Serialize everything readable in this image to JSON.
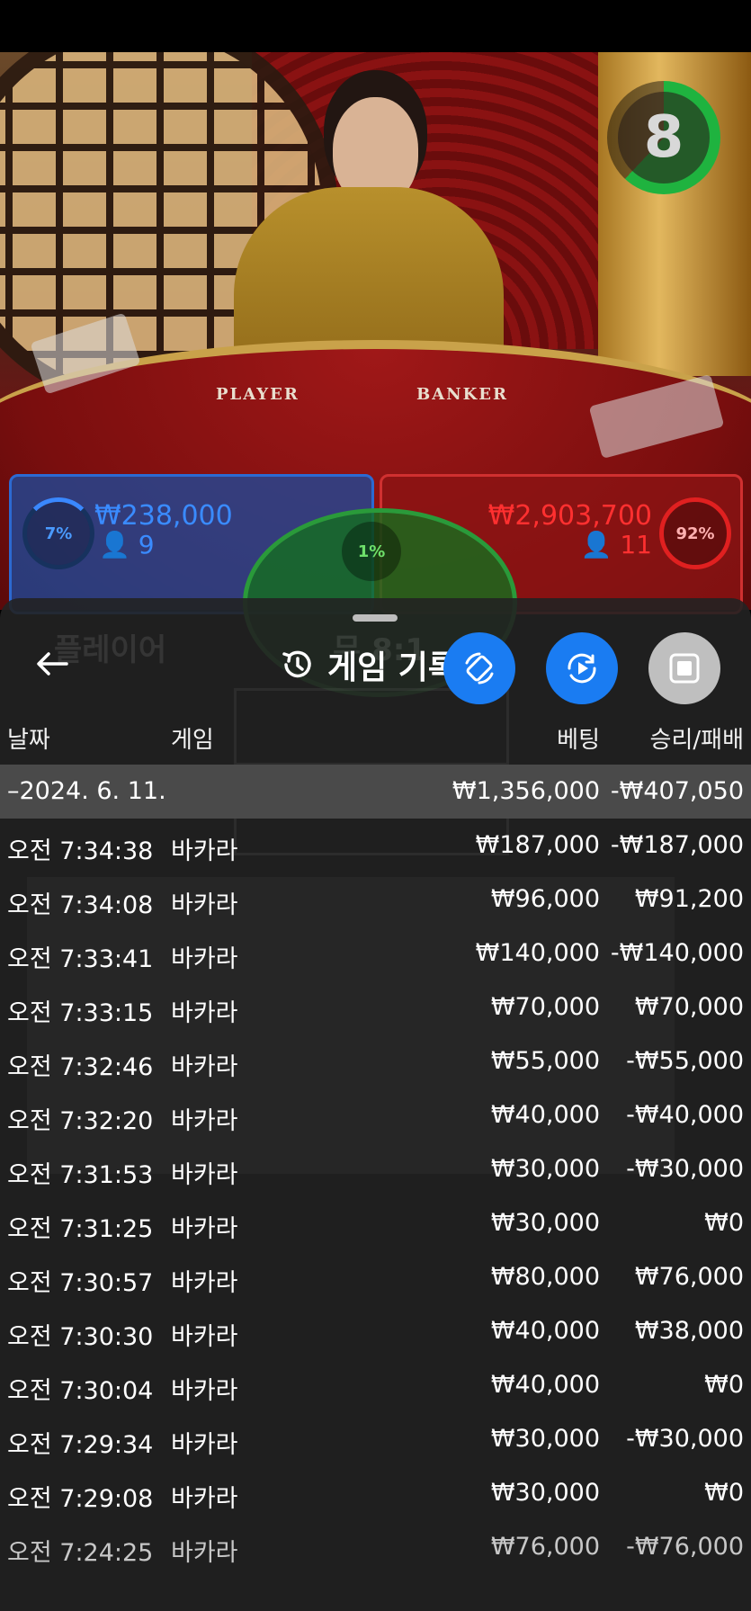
{
  "game_view": {
    "table_labels": [
      "PLAYER",
      "BANKER"
    ],
    "timer": "8",
    "player": {
      "percent": "7%",
      "amount": "₩238,000",
      "count": "9"
    },
    "tie": {
      "percent": "1%"
    },
    "banker": {
      "percent": "92%",
      "amount": "₩2,903,700",
      "count": "11"
    }
  },
  "history_sheet": {
    "title": "게임 기록",
    "icons": {
      "back": "arrow-left-icon",
      "history": "history-clock-icon",
      "rotate": "rotate-phone-icon",
      "autoplay": "autoplay-icon",
      "stop": "stop-icon"
    },
    "columns": {
      "date": "날짜",
      "game": "게임",
      "bet": "베팅",
      "win_loss": "승리/패배"
    },
    "date_group": {
      "date": "–2024. 6. 11.",
      "bet_total": "₩1,356,000",
      "win_loss_total": "-₩407,050"
    },
    "rows": [
      {
        "time": "오전 7:34:38",
        "game": "바카라",
        "bet": "₩187,000",
        "result": "-₩187,000"
      },
      {
        "time": "오전 7:34:08",
        "game": "바카라",
        "bet": "₩96,000",
        "result": "₩91,200"
      },
      {
        "time": "오전 7:33:41",
        "game": "바카라",
        "bet": "₩140,000",
        "result": "-₩140,000"
      },
      {
        "time": "오전 7:33:15",
        "game": "바카라",
        "bet": "₩70,000",
        "result": "₩70,000"
      },
      {
        "time": "오전 7:32:46",
        "game": "바카라",
        "bet": "₩55,000",
        "result": "-₩55,000"
      },
      {
        "time": "오전 7:32:20",
        "game": "바카라",
        "bet": "₩40,000",
        "result": "-₩40,000"
      },
      {
        "time": "오전 7:31:53",
        "game": "바카라",
        "bet": "₩30,000",
        "result": "-₩30,000"
      },
      {
        "time": "오전 7:31:25",
        "game": "바카라",
        "bet": "₩30,000",
        "result": "₩0"
      },
      {
        "time": "오전 7:30:57",
        "game": "바카라",
        "bet": "₩80,000",
        "result": "₩76,000"
      },
      {
        "time": "오전 7:30:30",
        "game": "바카라",
        "bet": "₩40,000",
        "result": "₩38,000"
      },
      {
        "time": "오전 7:30:04",
        "game": "바카라",
        "bet": "₩40,000",
        "result": "₩0"
      },
      {
        "time": "오전 7:29:34",
        "game": "바카라",
        "bet": "₩30,000",
        "result": "-₩30,000"
      },
      {
        "time": "오전 7:29:08",
        "game": "바카라",
        "bet": "₩30,000",
        "result": "₩0"
      },
      {
        "time": "오전 7:24:25",
        "game": "바카라",
        "bet": "₩76,000",
        "result": "-₩76,000"
      }
    ]
  },
  "colors": {
    "accent_blue": "#1a7cf2",
    "player_blue": "#3a8bff",
    "banker_red": "#ff3030",
    "tie_green": "#2a9a3a"
  }
}
